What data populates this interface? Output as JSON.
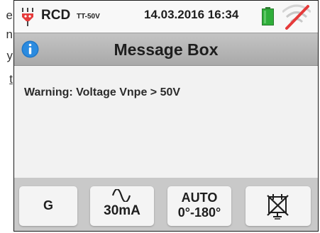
{
  "page_edge_fragments": [
    "e",
    "n",
    "y",
    "t"
  ],
  "status_bar": {
    "mode": "RCD",
    "mode_sub": "TT-50V",
    "datetime": "14.03.2016 16:34",
    "battery_icon": "battery-full-icon",
    "comm_icon": "wifi-off-icon",
    "rcd_icon": "rcd-plug-icon"
  },
  "title_bar": {
    "icon": "info-icon",
    "title": "Message Box"
  },
  "message": {
    "text": "Warning: Voltage Vnpe > 50V"
  },
  "softkeys": {
    "key1": {
      "label": "G"
    },
    "key2": {
      "icon": "ac-sine-wave-icon",
      "label": "30mA"
    },
    "key3": {
      "line1": "AUTO",
      "line2": "0°-180°"
    },
    "key4": {
      "icon": "no-socket-icon"
    }
  },
  "colors": {
    "title_bar": "#b5b5b5",
    "softkey_bar": "#c9c9c9",
    "battery": "#2fae3a",
    "info_icon": "#1f77c8",
    "warning_red": "#e53a3a"
  }
}
